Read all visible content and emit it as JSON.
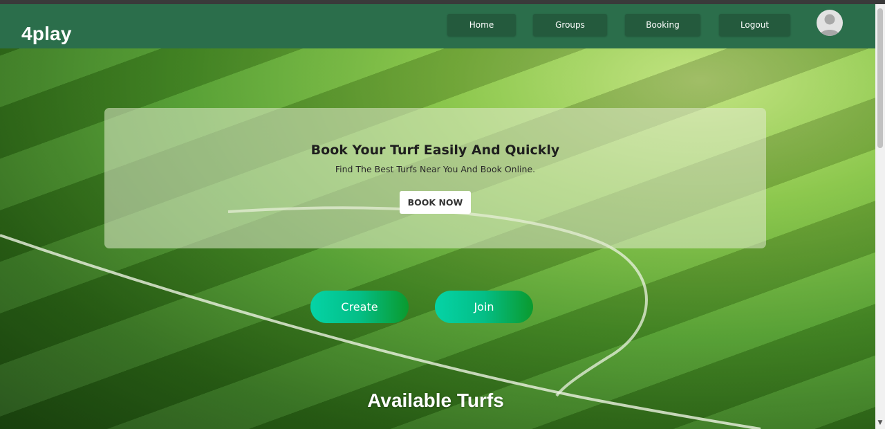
{
  "navbar": {
    "brand": "4play",
    "items": [
      {
        "label": "Home"
      },
      {
        "label": "Groups"
      },
      {
        "label": "Booking"
      },
      {
        "label": "Logout"
      }
    ],
    "avatar_icon": "user-avatar-icon",
    "background_color": "#2b6e4b",
    "button_color": "#245a3d"
  },
  "hero": {
    "title": "Book Your Turf Easily And Quickly",
    "subtitle": "Find The Best Turfs Near You And Book Online.",
    "button_label": "BOOK NOW"
  },
  "actions": {
    "create_label": "Create",
    "join_label": "Join",
    "gradient_start": "#05d3a6",
    "gradient_end": "#0a9a2e"
  },
  "section": {
    "title": "Available Turfs"
  },
  "scrollbar": {
    "down_arrow_icon": "scroll-down-arrow-icon"
  }
}
